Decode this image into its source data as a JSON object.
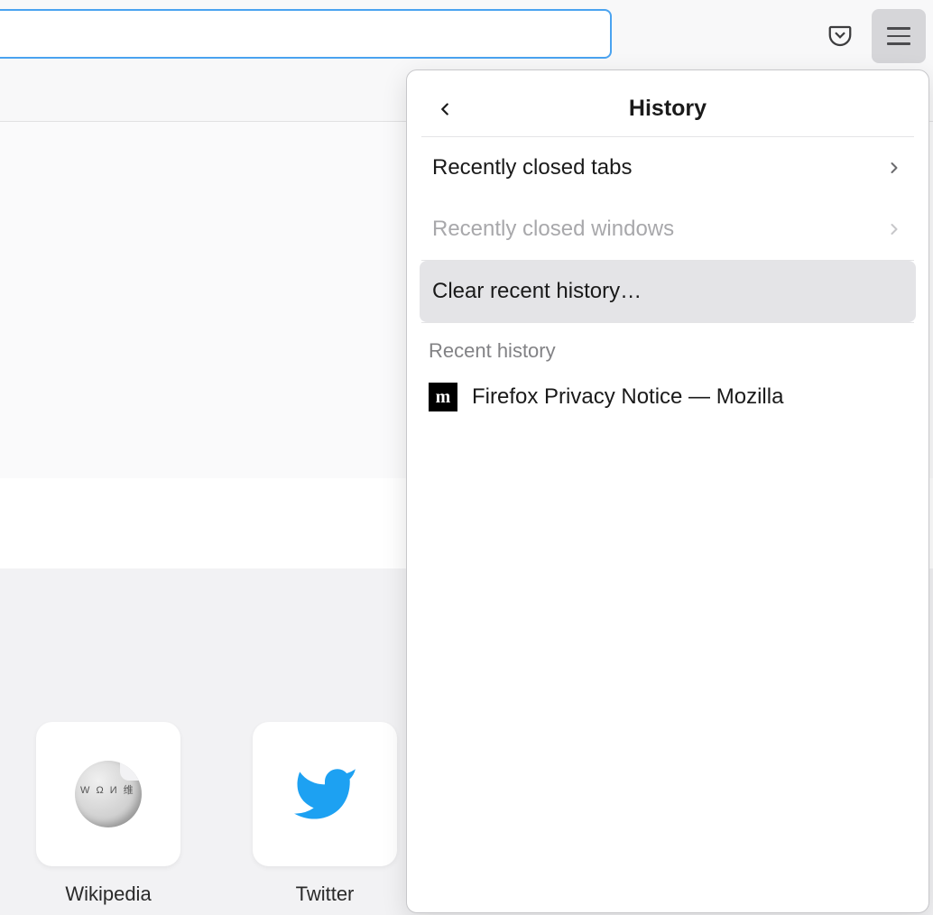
{
  "panel": {
    "title": "History",
    "items": {
      "recently_closed_tabs": "Recently closed tabs",
      "recently_closed_windows": "Recently closed windows",
      "clear_recent": "Clear recent history…"
    },
    "section_label": "Recent history",
    "history_entries": [
      {
        "title": "Firefox Privacy Notice — Mozilla",
        "favicon_letter": "m"
      }
    ]
  },
  "shortcuts": [
    {
      "name": "Wikipedia"
    },
    {
      "name": "Twitter"
    }
  ]
}
